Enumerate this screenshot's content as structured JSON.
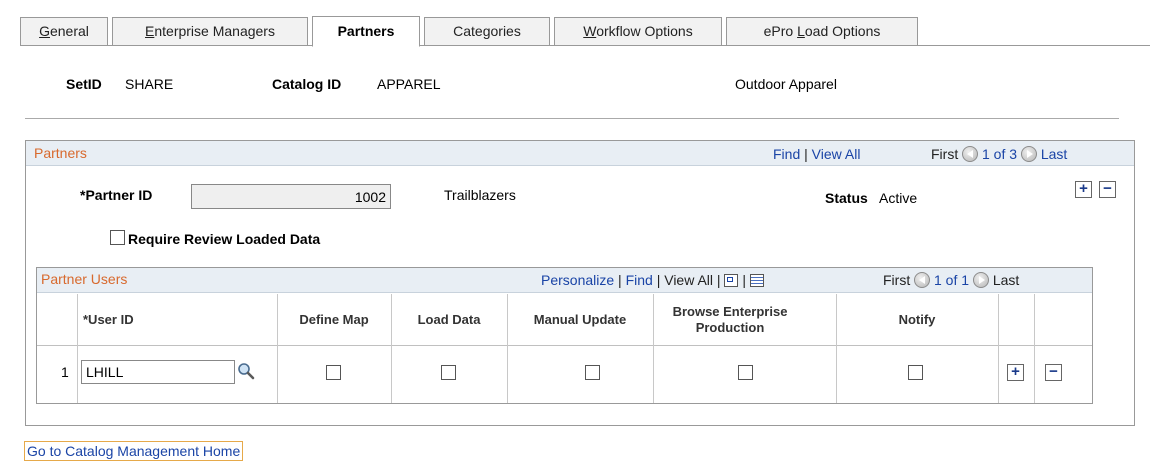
{
  "tabs": [
    {
      "label": "General",
      "underline": "G",
      "rest": "eneral",
      "active": false
    },
    {
      "label": "Enterprise Managers",
      "underline": "E",
      "rest": "nterprise Managers",
      "active": false
    },
    {
      "label": "Partners",
      "active": true
    },
    {
      "label": "Categories",
      "pre": "Cate",
      "underline": "g",
      "rest": "ories",
      "active": false
    },
    {
      "label": "Workflow Options",
      "underline": "W",
      "rest": "orkflow Options",
      "active": false
    },
    {
      "label": "ePro Load Options",
      "pre": "ePro ",
      "underline": "L",
      "rest": "oad Options",
      "active": false
    }
  ],
  "header": {
    "setid_label": "SetID",
    "setid_value": "SHARE",
    "catalog_label": "Catalog ID",
    "catalog_value": "APPAREL",
    "catalog_desc": "Outdoor Apparel"
  },
  "partners": {
    "title": "Partners",
    "find": "Find",
    "view_all": "View All",
    "first": "First",
    "counter": "1 of 3",
    "last": "Last",
    "partner_id_label": "*Partner ID",
    "partner_id_value": "1002",
    "partner_name": "Trailblazers",
    "status_label": "Status",
    "status_value": "Active",
    "require_review_label": "Require Review Loaded Data",
    "require_review_checked": false
  },
  "partner_users": {
    "title": "Partner Users",
    "personalize": "Personalize",
    "find": "Find",
    "view_all": "View All",
    "first": "First",
    "counter": "1 of 1",
    "last": "Last",
    "columns": [
      "*User ID",
      "Define Map",
      "Load Data",
      "Manual Update",
      "Browse Enterprise Production",
      "Notify"
    ],
    "rows": [
      {
        "row_num": "1",
        "user_id": "LHILL",
        "define_map": false,
        "load_data": false,
        "manual_update": false,
        "browse_enterprise_production": false,
        "notify": false
      }
    ]
  },
  "footer": {
    "home_link": "Go to Catalog Management Home"
  },
  "colors": {
    "link": "#1a44a6",
    "section_title": "#d8692d",
    "header_bg": "#e8eef4"
  }
}
